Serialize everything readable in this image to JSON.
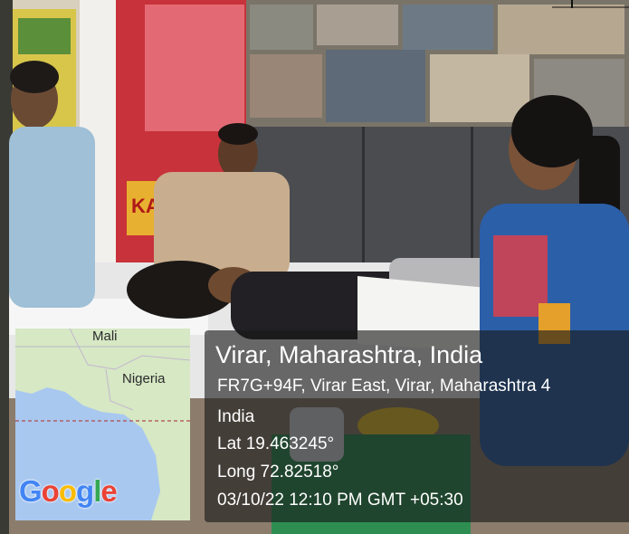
{
  "location": {
    "title": "Virar, Maharashtra, India",
    "address": "FR7G+94F, Virar East, Virar, Maharashtra 4",
    "country": "India",
    "lat": "Lat 19.463245°",
    "long": "Long 72.82518°",
    "datetime": "03/10/22 12:10 PM GMT +05:30"
  },
  "map": {
    "labels": [
      "Mali",
      "Nigeria"
    ],
    "logo": [
      "G",
      "o",
      "o",
      "g",
      "l",
      "e"
    ],
    "logo_colors": [
      "#4285F4",
      "#EA4335",
      "#FBBC05",
      "#4285F4",
      "#34A853",
      "#EA4335"
    ],
    "land_color": "#d6e8c4",
    "water_color": "#a8c8f0"
  },
  "photo": {
    "poster_text": "KA KA",
    "icon": "photo-scene"
  }
}
